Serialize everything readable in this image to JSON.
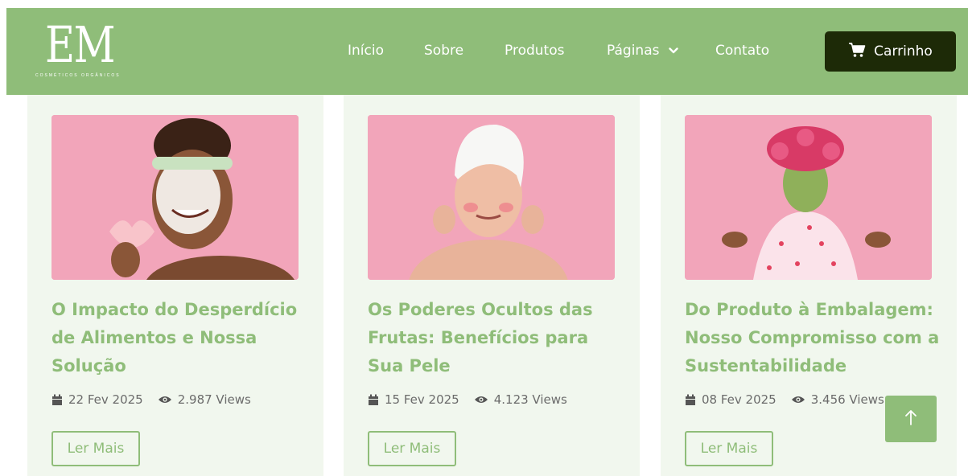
{
  "brand": {
    "logo_text": "EM",
    "logo_subtitle": "COSMÉTICOS ORGÂNICOS",
    "primary_color": "#8fbd79",
    "dark_color": "#1d2a07"
  },
  "nav": {
    "items": [
      {
        "label": "Início"
      },
      {
        "label": "Sobre"
      },
      {
        "label": "Produtos"
      },
      {
        "label": "Páginas",
        "has_dropdown": true,
        "icon": "chevron-down-icon"
      },
      {
        "label": "Contato"
      }
    ],
    "cart_label": "Carrinho",
    "cart_icon": "shopping-cart-icon"
  },
  "posts": [
    {
      "title": "O Impacto do Desperdício de Alimentos e Nossa Solução",
      "date": "22 Fev 2025",
      "views": "2.987 Views",
      "button_label": "Ler Mais"
    },
    {
      "title": "Os Poderes Ocultos das Frutas: Benefícios para Sua Pele",
      "date": "15 Fev 2025",
      "views": "4.123 Views",
      "button_label": "Ler Mais"
    },
    {
      "title": "Do Produto à Embalagem: Nosso Compromisso com a Sustentabilidade",
      "date": "08 Fev 2025",
      "views": "3.456 Views",
      "button_label": "Ler Mais"
    }
  ],
  "scroll_top": {
    "icon": "arrow-up-icon"
  }
}
